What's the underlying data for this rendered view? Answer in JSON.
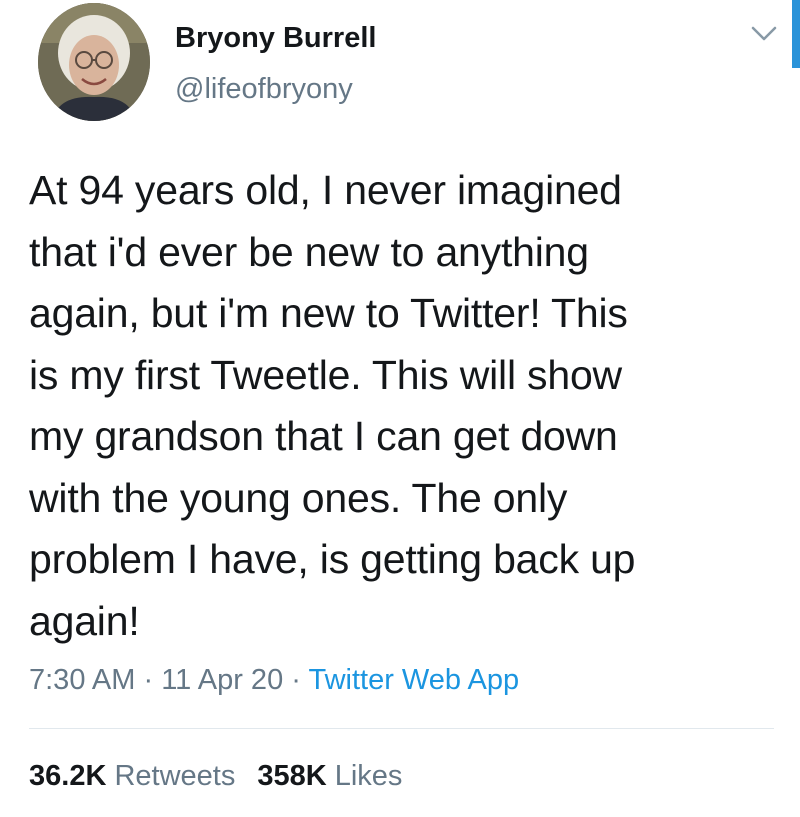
{
  "user": {
    "name": "Bryony Burrell",
    "handle": "@lifeofbryony"
  },
  "tweet": {
    "lines": [
      "At 94 years old, I never imagined",
      "that i'd ever be new to anything",
      "again, but i'm new to Twitter! This",
      "is my first Tweetle. This will show",
      "my grandson that I can get down",
      "with the young ones. The only",
      "problem I have, is getting back up",
      "again!"
    ],
    "time": "7:30 AM",
    "date": "11 Apr 20",
    "separator": " · ",
    "source": "Twitter Web App"
  },
  "stats": {
    "retweets_count": "36.2K",
    "retweets_label": "Retweets",
    "likes_count": "358K",
    "likes_label": "Likes"
  },
  "icons": {
    "caret": "chevron-down-icon"
  },
  "colors": {
    "text": "#14171a",
    "secondary": "#657786",
    "link": "#1b95e0",
    "divider": "#e1e8ed"
  }
}
